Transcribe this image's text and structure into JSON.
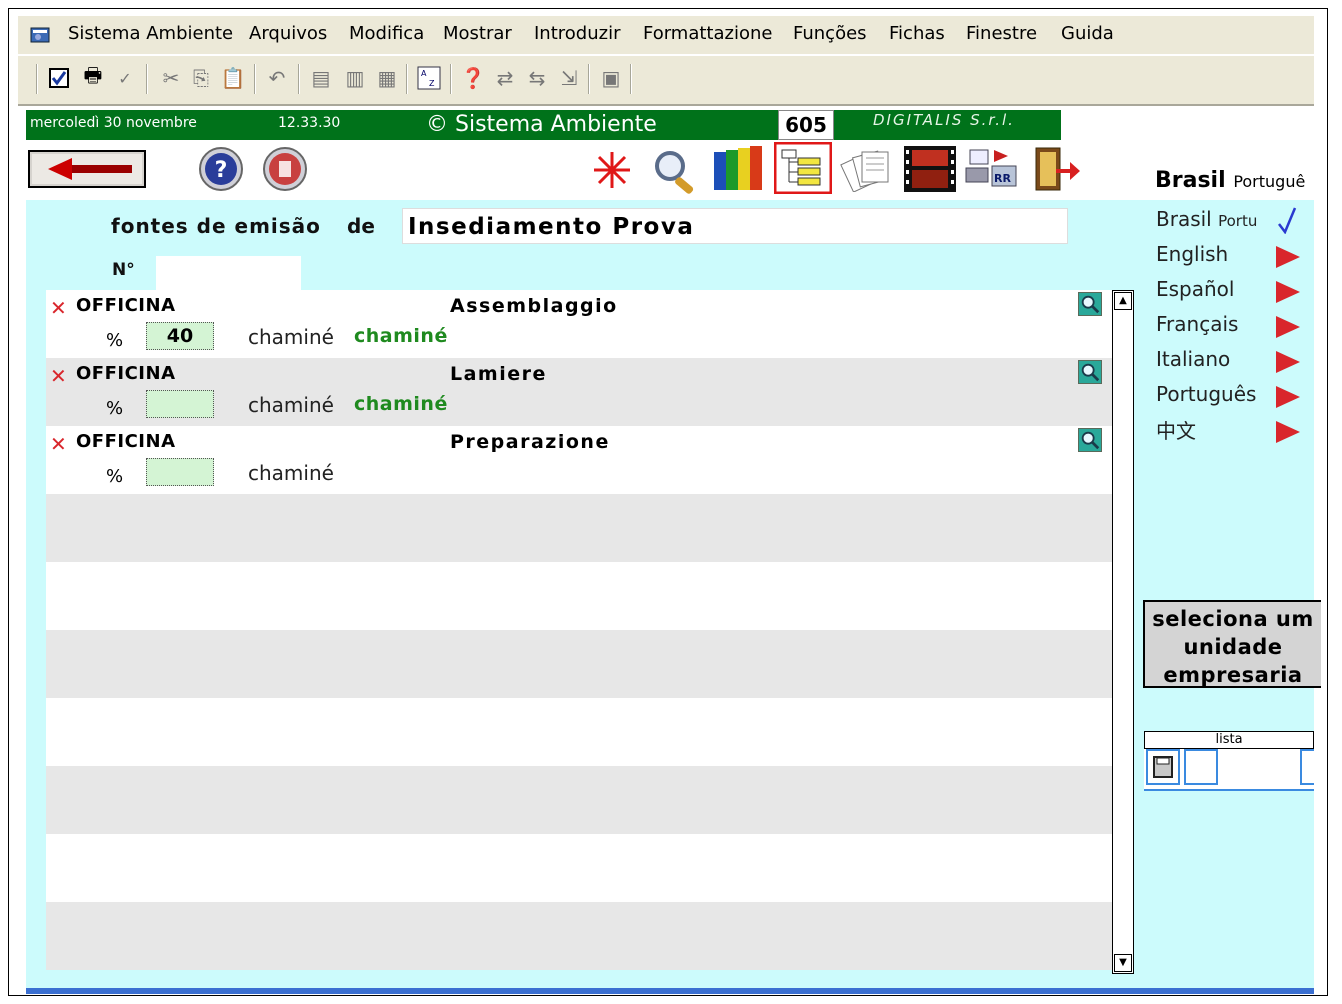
{
  "menu": [
    "Sistema Ambiente",
    "Arquivos",
    "Modifica",
    "Mostrar",
    "Introduzir",
    "Formattazione",
    "Funções",
    "Fichas",
    "Finestre",
    "Guida"
  ],
  "status": {
    "date": "mercoledì 30 novembre",
    "time": "12.33.30",
    "app": "© Sistema Ambiente",
    "counter": "605",
    "company": "DIGITALIS S.r.l."
  },
  "form": {
    "title_label": "fontes de emisão",
    "de_label": "de",
    "plant_name": "Insediamento Prova",
    "number_label": "N°",
    "number_value": ""
  },
  "rows": [
    {
      "type": "OFFICINA",
      "name": "Assemblaggio",
      "pct_label": "%",
      "pct_value": "40",
      "chimney_label": "chaminé",
      "chimney_value": "chaminé"
    },
    {
      "type": "OFFICINA",
      "name": "Lamiere",
      "pct_label": "%",
      "pct_value": "",
      "chimney_label": "chaminé",
      "chimney_value": "chaminé"
    },
    {
      "type": "OFFICINA",
      "name": "Preparazione",
      "pct_label": "%",
      "pct_value": "",
      "chimney_label": "chaminé",
      "chimney_value": ""
    }
  ],
  "language_panel": {
    "current": "Brasil",
    "current_sub": "Portuguê",
    "selected": "Brasil",
    "selected_sub": "Portu",
    "options": [
      "English",
      "Español",
      "Français",
      "Italiano",
      "Português",
      "中文"
    ]
  },
  "select_unit_button": "seleciona um unidade empresaria",
  "lista_label": "lista",
  "colors": {
    "status_green": "#00721a",
    "form_bg": "#ccfbfc",
    "row_alt": "#e7e7e7",
    "accent_red": "#d9262c",
    "link_green": "#1f8a1f"
  }
}
